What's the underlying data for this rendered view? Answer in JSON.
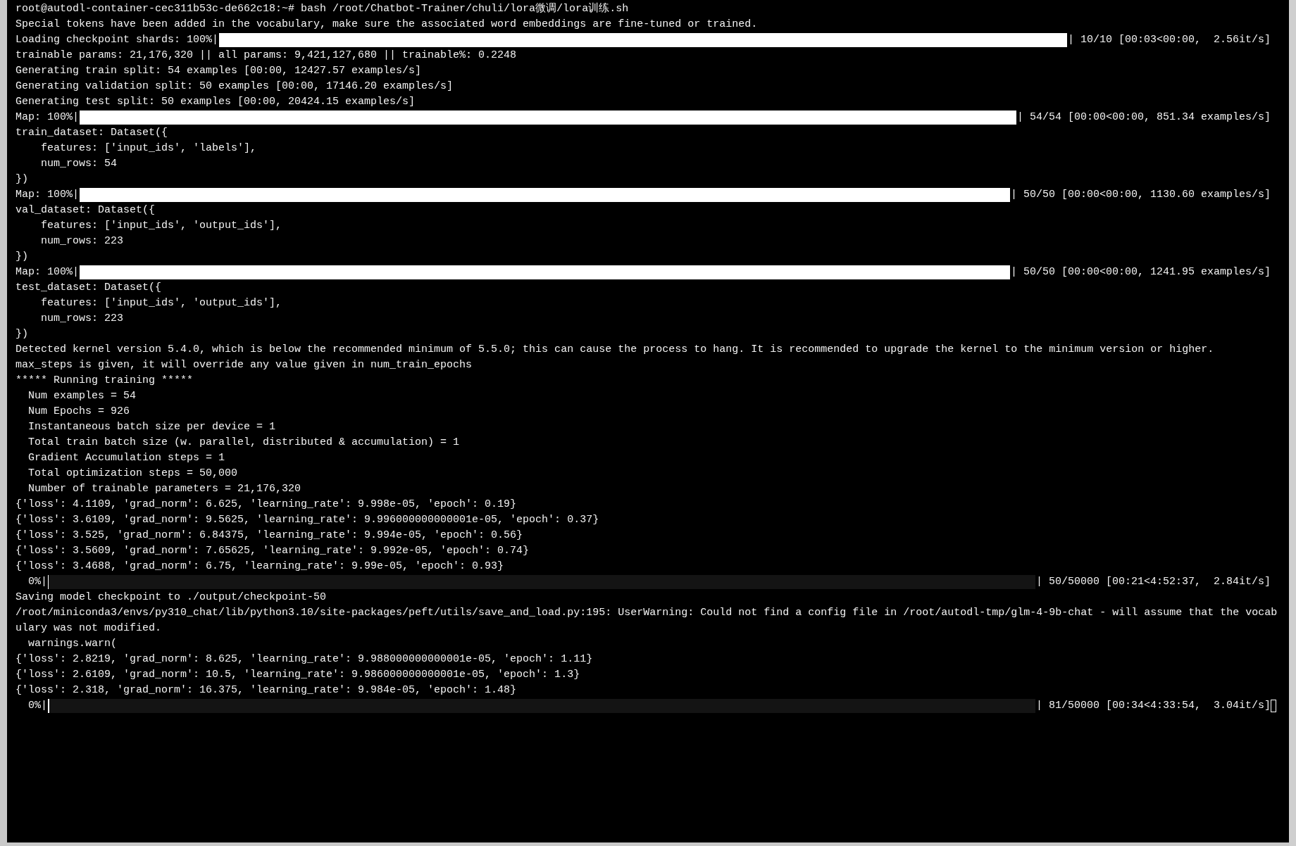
{
  "terminal": {
    "lines": [
      {
        "kind": "text",
        "text": "root@autodl-container-cec311b53c-de662c18:~# bash /root/Chatbot-Trainer/chuli/lora微调/lora训练.sh"
      },
      {
        "kind": "text",
        "text": "Special tokens have been added in the vocabulary, make sure the associated word embeddings are fine-tuned or trained."
      },
      {
        "kind": "progress",
        "prefix": "Loading checkpoint shards: 100%|",
        "level": 1,
        "suffix": "| 10/10 [00:03<00:00,  2.56it/s]"
      },
      {
        "kind": "text",
        "text": "trainable params: 21,176,320 || all params: 9,421,127,680 || trainable%: 0.2248"
      },
      {
        "kind": "text",
        "text": "Generating train split: 54 examples [00:00, 12427.57 examples/s]"
      },
      {
        "kind": "text",
        "text": "Generating validation split: 50 examples [00:00, 17146.20 examples/s]"
      },
      {
        "kind": "text",
        "text": "Generating test split: 50 examples [00:00, 20424.15 examples/s]"
      },
      {
        "kind": "progress",
        "prefix": "Map: 100%|",
        "level": 1,
        "suffix": "| 54/54 [00:00<00:00, 851.34 examples/s]"
      },
      {
        "kind": "text",
        "text": "train_dataset: Dataset({"
      },
      {
        "kind": "text",
        "text": "    features: ['input_ids', 'labels'],"
      },
      {
        "kind": "text",
        "text": "    num_rows: 54"
      },
      {
        "kind": "text",
        "text": "})"
      },
      {
        "kind": "progress",
        "prefix": "Map: 100%|",
        "level": 1,
        "suffix": "| 50/50 [00:00<00:00, 1130.60 examples/s]"
      },
      {
        "kind": "text",
        "text": "val_dataset: Dataset({"
      },
      {
        "kind": "text",
        "text": "    features: ['input_ids', 'output_ids'],"
      },
      {
        "kind": "text",
        "text": "    num_rows: 223"
      },
      {
        "kind": "text",
        "text": "})"
      },
      {
        "kind": "progress",
        "prefix": "Map: 100%|",
        "level": 1,
        "suffix": "| 50/50 [00:00<00:00, 1241.95 examples/s]"
      },
      {
        "kind": "text",
        "text": "test_dataset: Dataset({"
      },
      {
        "kind": "text",
        "text": "    features: ['input_ids', 'output_ids'],"
      },
      {
        "kind": "text",
        "text": "    num_rows: 223"
      },
      {
        "kind": "text",
        "text": "})"
      },
      {
        "kind": "text",
        "text": "Detected kernel version 5.4.0, which is below the recommended minimum of 5.5.0; this can cause the process to hang. It is recommended to upgrade the kernel to the minimum version or higher."
      },
      {
        "kind": "text",
        "text": "max_steps is given, it will override any value given in num_train_epochs"
      },
      {
        "kind": "text",
        "text": "***** Running training *****"
      },
      {
        "kind": "text",
        "text": "  Num examples = 54"
      },
      {
        "kind": "text",
        "text": "  Num Epochs = 926"
      },
      {
        "kind": "text",
        "text": "  Instantaneous batch size per device = 1"
      },
      {
        "kind": "text",
        "text": "  Total train batch size (w. parallel, distributed & accumulation) = 1"
      },
      {
        "kind": "text",
        "text": "  Gradient Accumulation steps = 1"
      },
      {
        "kind": "text",
        "text": "  Total optimization steps = 50,000"
      },
      {
        "kind": "text",
        "text": "  Number of trainable parameters = 21,176,320"
      },
      {
        "kind": "text",
        "text": "{'loss': 4.1109, 'grad_norm': 6.625, 'learning_rate': 9.998e-05, 'epoch': 0.19}"
      },
      {
        "kind": "text",
        "text": "{'loss': 3.6109, 'grad_norm': 9.5625, 'learning_rate': 9.996000000000001e-05, 'epoch': 0.37}"
      },
      {
        "kind": "text",
        "text": "{'loss': 3.525, 'grad_norm': 6.84375, 'learning_rate': 9.994e-05, 'epoch': 0.56}"
      },
      {
        "kind": "text",
        "text": "{'loss': 3.5609, 'grad_norm': 7.65625, 'learning_rate': 9.992e-05, 'epoch': 0.74}"
      },
      {
        "kind": "text",
        "text": "{'loss': 3.4688, 'grad_norm': 6.75, 'learning_rate': 9.99e-05, 'epoch': 0.93}"
      },
      {
        "kind": "progress",
        "prefix": "  0%|",
        "level": 0.001,
        "suffix": "| 50/50000 [00:21<4:52:37,  2.84it/s]"
      },
      {
        "kind": "text",
        "text": "Saving model checkpoint to ./output/checkpoint-50"
      },
      {
        "kind": "text",
        "text": "/root/miniconda3/envs/py310_chat/lib/python3.10/site-packages/peft/utils/save_and_load.py:195: UserWarning: Could not find a config file in /root/autodl-tmp/glm-4-9b-chat - will assume that the vocab"
      },
      {
        "kind": "text",
        "text": "ulary was not modified."
      },
      {
        "kind": "text",
        "text": "  warnings.warn("
      },
      {
        "kind": "text",
        "text": "{'loss': 2.8219, 'grad_norm': 8.625, 'learning_rate': 9.988000000000001e-05, 'epoch': 1.11}"
      },
      {
        "kind": "text",
        "text": "{'loss': 2.6109, 'grad_norm': 10.5, 'learning_rate': 9.986000000000001e-05, 'epoch': 1.3}"
      },
      {
        "kind": "text",
        "text": "{'loss': 2.318, 'grad_norm': 16.375, 'learning_rate': 9.984e-05, 'epoch': 1.48}"
      },
      {
        "kind": "progress",
        "prefix": "  0%|",
        "level": 0.00162,
        "suffix": "| 81/50000 [00:34<4:33:54,  3.04it/s]",
        "cursor": true
      }
    ]
  }
}
